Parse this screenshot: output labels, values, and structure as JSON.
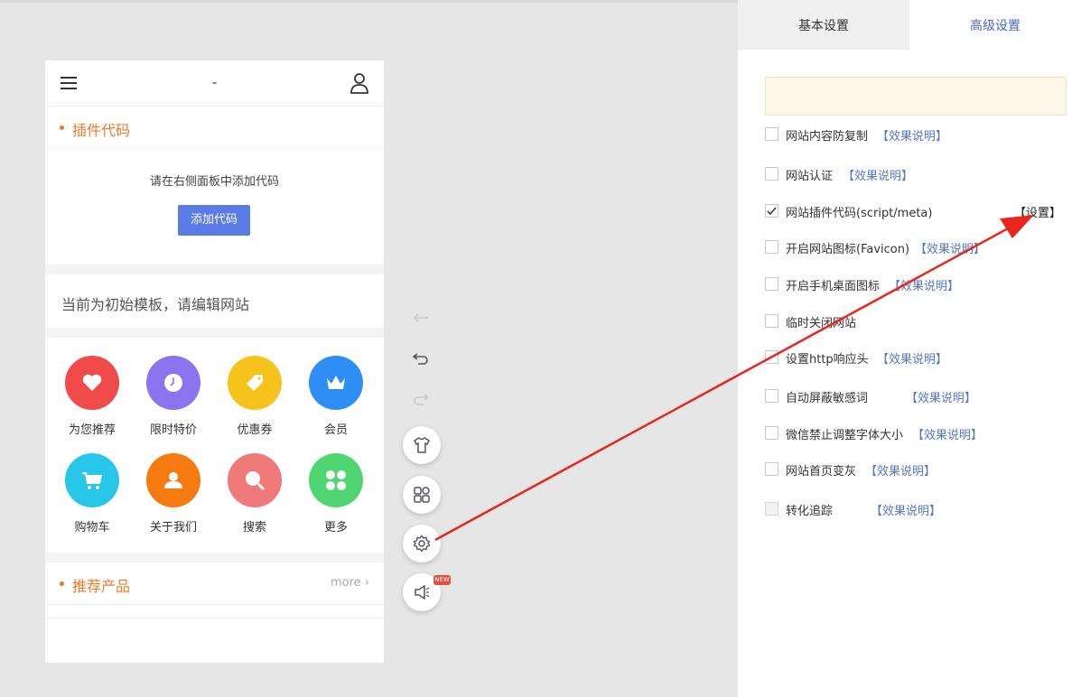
{
  "phone": {
    "title": "-",
    "plugin": {
      "title": "插件代码",
      "hint": "请在右侧面板中添加代码",
      "button": "添加代码"
    },
    "template_note": "当前为初始模板，请编辑网站",
    "grid": [
      {
        "label": "为您推荐",
        "icon": "heart-icon",
        "color": "#f04a4a"
      },
      {
        "label": "限时特价",
        "icon": "clock-icon",
        "color": "#8a74f0"
      },
      {
        "label": "优惠券",
        "icon": "tag-icon",
        "color": "#f6c21c"
      },
      {
        "label": "会员",
        "icon": "crown-icon",
        "color": "#2f8ef5"
      },
      {
        "label": "购物车",
        "icon": "cart-icon",
        "color": "#28c6e8"
      },
      {
        "label": "关于我们",
        "icon": "people-icon",
        "color": "#f57a10"
      },
      {
        "label": "搜索",
        "icon": "search-icon",
        "color": "#f07a7a"
      },
      {
        "label": "更多",
        "icon": "more-grid-icon",
        "color": "#4fd672"
      }
    ],
    "products": {
      "title": "推荐产品",
      "more": "more"
    }
  },
  "toolbar": {
    "new_badge": "NEW"
  },
  "panel": {
    "tabs": {
      "basic": "基本设置",
      "advanced": "高级设置"
    },
    "options": [
      {
        "label": "网站内容防复制",
        "link": "【效果说明】",
        "checked": false
      },
      {
        "label": "网站认证",
        "link": "【效果说明】",
        "checked": false
      },
      {
        "label": "网站插件代码(script/meta)",
        "link": "【设置】",
        "checked": true
      },
      {
        "label": "开启网站图标(Favicon)",
        "link": "【效果说明】",
        "checked": false
      },
      {
        "label": "开启手机桌面图标",
        "link": "【效果说明】",
        "checked": false
      },
      {
        "label": "临时关闭网站",
        "link": "",
        "checked": false
      },
      {
        "label": "设置http响应头",
        "link": "【效果说明】",
        "checked": false
      },
      {
        "label": "自动屏蔽敏感词",
        "link": "【效果说明】",
        "checked": false
      },
      {
        "label": "微信禁止调整字体大小",
        "link": "【效果说明】",
        "checked": false
      },
      {
        "label": "网站首页变灰",
        "link": "【效果说明】",
        "checked": false
      },
      {
        "label": "转化追踪",
        "link": "【效果说明】",
        "checked": false,
        "disabled": true
      }
    ]
  },
  "colors": {
    "accent_orange": "#f07a2a",
    "primary_blue": "#5b7be6",
    "link_blue": "#5577c8",
    "arrow_red": "#e8261e"
  }
}
